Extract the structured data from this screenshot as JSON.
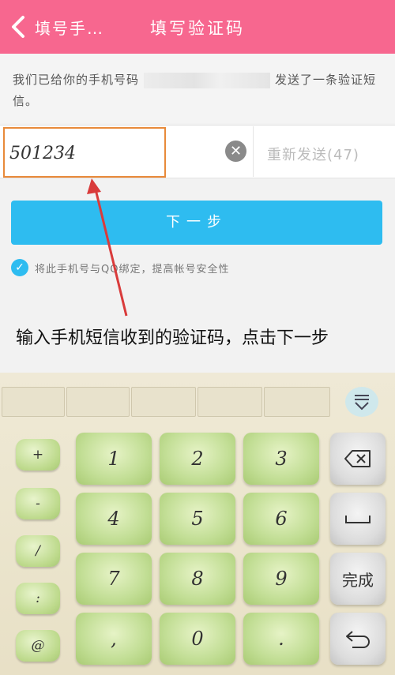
{
  "header": {
    "back_label": "填号手…",
    "title": "填写验证码",
    "bg_color": "#f7678f"
  },
  "info": {
    "text_before": "我们已给你的手机号码",
    "text_after": "发送了一条验证短信。"
  },
  "code": {
    "value": "501234",
    "resend_label": "重新发送(47)"
  },
  "next_button": {
    "label": "下一步",
    "color": "#2ebcf0"
  },
  "bind_checkbox": {
    "checked": true,
    "label": "将此手机号与QQ绑定，提高帐号安全性"
  },
  "annotation": {
    "instruction": "输入手机短信收到的验证码，点击下一步"
  },
  "keyboard": {
    "symbol_keys": [
      "+",
      "-",
      "/",
      ":",
      "@"
    ],
    "number_keys": [
      "1",
      "2",
      "3",
      "4",
      "5",
      "6",
      "7",
      "8",
      "9",
      ",",
      "0",
      "."
    ],
    "done_label": "完成",
    "icons": [
      "backspace-icon",
      "space-icon",
      "return-icon",
      "collapse-keyboard-icon"
    ]
  }
}
